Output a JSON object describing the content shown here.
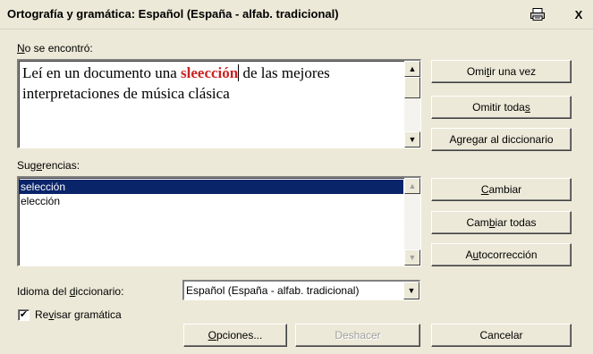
{
  "window": {
    "title": "Ortografía y gramática: Español (España - alfab. tradicional)",
    "print_icon": "printer-icon",
    "close_glyph": "X"
  },
  "not_found": {
    "label_underline": "N",
    "label_rest": "o se encontró:",
    "text_before": "Leí en un documento una ",
    "misspelled": "sleección",
    "text_after": " de las mejores interpretaciones de música clásica"
  },
  "suggestions": {
    "label_pre": "Sug",
    "label_underline": "e",
    "label_post": "rencias:",
    "items": [
      "selección",
      "elección"
    ],
    "selected_index": 0
  },
  "buttons": {
    "ignore_once_pre": "Omi",
    "ignore_once_u": "t",
    "ignore_once_post": "ir una vez",
    "ignore_all_pre": "Omitir toda",
    "ignore_all_u": "s",
    "ignore_all_post": "",
    "add_pre": "A",
    "add_u": "g",
    "add_post": "regar al diccionario",
    "change_pre": "",
    "change_u": "C",
    "change_post": "ambiar",
    "change_all_pre": "Cam",
    "change_all_u": "b",
    "change_all_post": "iar todas",
    "autocorrect_pre": "A",
    "autocorrect_u": "u",
    "autocorrect_post": "tocorrección",
    "options_pre": "",
    "options_u": "O",
    "options_post": "pciones...",
    "undo": "Deshacer",
    "cancel": "Cancelar"
  },
  "dictionary": {
    "label_pre": "Idioma del ",
    "label_u": "d",
    "label_post": "iccionario:",
    "value": "Español (España - alfab. tradicional)"
  },
  "grammar_check": {
    "label_pre": "Re",
    "label_u": "v",
    "label_post": "isar gramática",
    "checked": true,
    "check_glyph": "✔"
  },
  "glyphs": {
    "up": "▲",
    "down": "▼"
  }
}
